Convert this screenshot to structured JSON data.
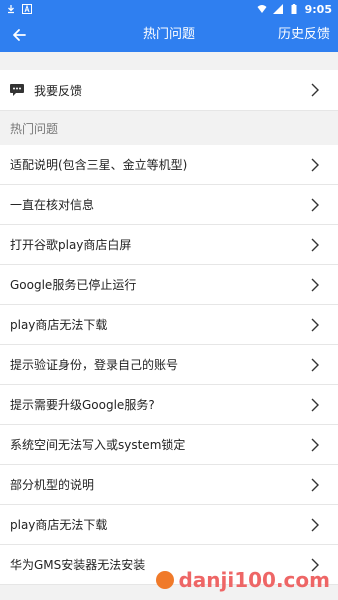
{
  "status_bar": {
    "time": "9:05",
    "left_icons": [
      "download-icon",
      "a-icon"
    ],
    "right_icons": [
      "wifi-icon",
      "signal-icon",
      "battery-icon"
    ]
  },
  "app_bar": {
    "title": "热门问题",
    "history_label": "历史反馈"
  },
  "feedback": {
    "label": "我要反馈",
    "icon": "message-icon"
  },
  "section": {
    "header": "热门问题"
  },
  "items": [
    {
      "label": "适配说明(包含三星、金立等机型)"
    },
    {
      "label": "一直在核对信息"
    },
    {
      "label": "打开谷歌play商店白屏"
    },
    {
      "label": "Google服务已停止运行"
    },
    {
      "label": "play商店无法下载"
    },
    {
      "label": "提示验证身份，登录自己的账号"
    },
    {
      "label": "提示需要升级Google服务?"
    },
    {
      "label": "系统空间无法写入或system锁定"
    },
    {
      "label": "部分机型的说明"
    },
    {
      "label": "play商店无法下载"
    },
    {
      "label": "华为GMS安装器无法安装"
    }
  ],
  "watermark": {
    "text": "danji100.com"
  },
  "colors": {
    "primary": "#2f7ff0",
    "background": "#f2f2f2",
    "divider": "#e6e6e6"
  }
}
